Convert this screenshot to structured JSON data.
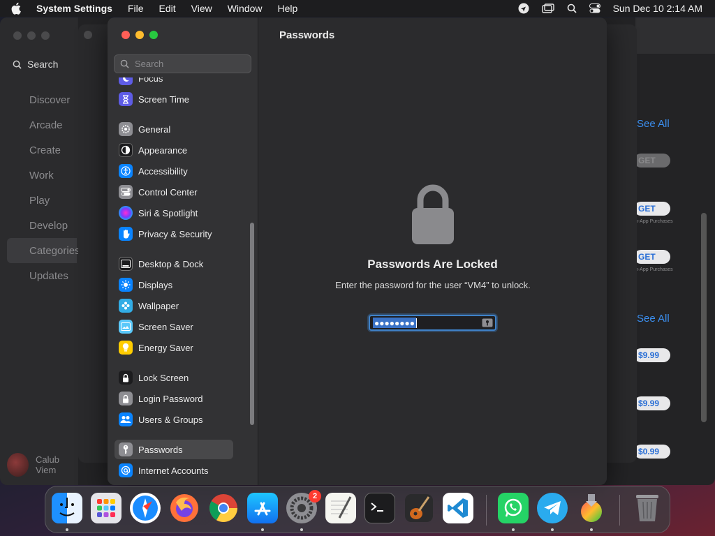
{
  "menubar": {
    "app_name": "System Settings",
    "menus": [
      "File",
      "Edit",
      "View",
      "Window",
      "Help"
    ],
    "clock": "Sun Dec 10  2:14 AM"
  },
  "appstore": {
    "search_label": "Search",
    "nav": [
      "Discover",
      "Arcade",
      "Create",
      "Work",
      "Play",
      "Develop",
      "Categories",
      "Updates"
    ],
    "selected_nav": "Categories",
    "user_name": "Calub Viem",
    "see_all_1": "See All",
    "see_all_2": "See All",
    "buttons": [
      "GET",
      "GET",
      "GET",
      "$9.99",
      "$9.99",
      "$0.99"
    ],
    "in_app_1": "In-App Purchases",
    "in_app_2": "In-App Purchases"
  },
  "settings": {
    "search_placeholder": "Search",
    "sidebar": {
      "focus": "Focus",
      "screen_time": "Screen Time",
      "general": "General",
      "appearance": "Appearance",
      "accessibility": "Accessibility",
      "control_center": "Control Center",
      "siri_spotlight": "Siri & Spotlight",
      "privacy_security": "Privacy & Security",
      "desktop_dock": "Desktop & Dock",
      "displays": "Displays",
      "wallpaper": "Wallpaper",
      "screen_saver": "Screen Saver",
      "energy_saver": "Energy Saver",
      "lock_screen": "Lock Screen",
      "login_password": "Login Password",
      "users_groups": "Users & Groups",
      "passwords": "Passwords",
      "internet_accounts": "Internet Accounts"
    },
    "selected": "Passwords",
    "page_title": "Passwords",
    "locked_title": "Passwords Are Locked",
    "locked_message": "Enter the password for the user “VM4” to unlock.",
    "password_value": "●●●●●●●●"
  },
  "dock": {
    "apps": [
      "Finder",
      "Launchpad",
      "Safari",
      "Firefox",
      "Chrome",
      "App Store",
      "System Settings",
      "TextEdit",
      "Terminal",
      "GarageBand",
      "Visual Studio Code",
      "WhatsApp",
      "Telegram",
      "Installer",
      "Trash"
    ],
    "settings_badge": "2"
  },
  "colors": {
    "accent": "#3f82c8",
    "close": "#ff5f57",
    "minimize": "#febc2e",
    "maximize": "#28c840"
  }
}
